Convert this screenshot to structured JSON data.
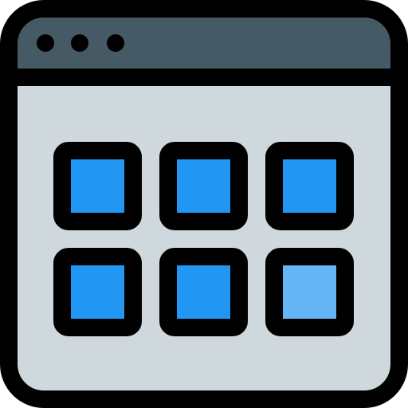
{
  "icon": {
    "name": "browser-app-grid-icon",
    "colors": {
      "outline": "#000000",
      "title_bar": "#455a64",
      "window_body": "#cfd8dc",
      "tile": "#2196f3",
      "tile_highlight": "#64b5f6"
    },
    "window_dots": 3,
    "tiles": [
      {
        "name": "tile-1",
        "color": "#2196f3"
      },
      {
        "name": "tile-2",
        "color": "#2196f3"
      },
      {
        "name": "tile-3",
        "color": "#2196f3"
      },
      {
        "name": "tile-4",
        "color": "#2196f3"
      },
      {
        "name": "tile-5",
        "color": "#2196f3"
      },
      {
        "name": "tile-6",
        "color": "#64b5f6"
      }
    ]
  }
}
